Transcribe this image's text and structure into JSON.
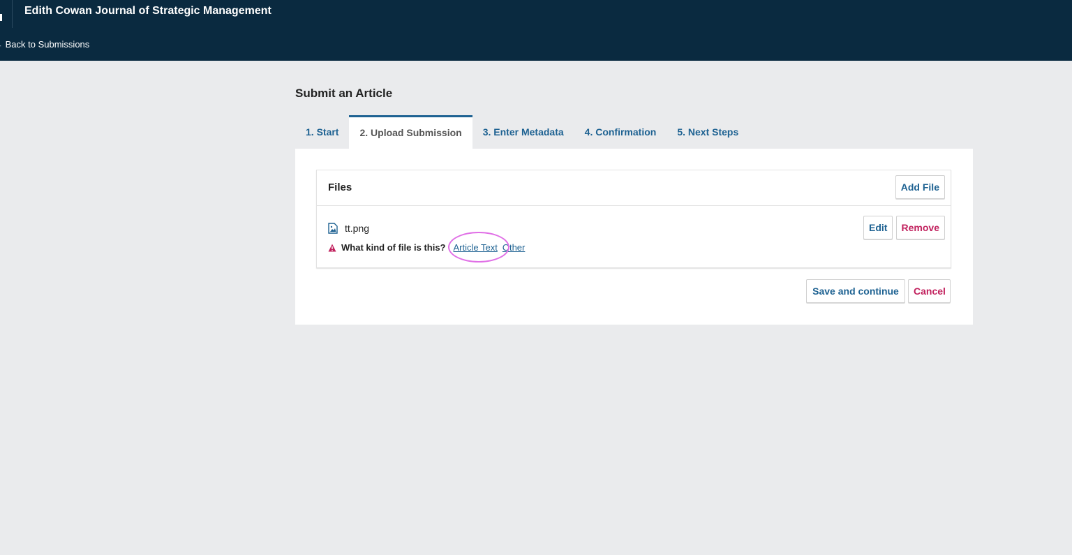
{
  "header": {
    "journal_title": "Edith Cowan Journal of Strategic Management",
    "back_link": "← Back to Submissions"
  },
  "page": {
    "title": "Submit an Article"
  },
  "tabs": [
    {
      "label": "1. Start"
    },
    {
      "label": "2. Upload Submission",
      "active": true
    },
    {
      "label": "3. Enter Metadata"
    },
    {
      "label": "4. Confirmation"
    },
    {
      "label": "5. Next Steps"
    }
  ],
  "files": {
    "title": "Files",
    "add_label": "Add File",
    "items": [
      {
        "name": "tt.png",
        "icon": "image-file-icon",
        "edit_label": "Edit",
        "remove_label": "Remove",
        "question": "What kind of file is this?",
        "options": [
          "Article Text",
          "Other"
        ]
      }
    ]
  },
  "actions": {
    "save_label": "Save and continue",
    "cancel_label": "Cancel"
  },
  "colors": {
    "header_bg": "#0a2a40",
    "link": "#1e6292",
    "danger": "#c1205d",
    "highlight": "#e06fe6"
  }
}
